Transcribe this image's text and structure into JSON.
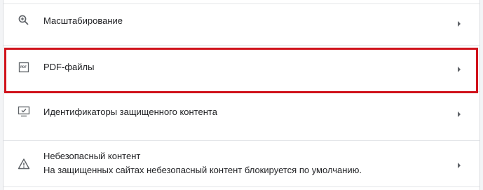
{
  "settings": {
    "rows": [
      {
        "icon": "zoom-icon",
        "label": "Масштабирование"
      },
      {
        "icon": "pdf-icon",
        "label": "PDF-файлы",
        "pdf_badge": "PDF"
      },
      {
        "icon": "protected-content-icon",
        "label": "Идентификаторы защищенного контента"
      },
      {
        "icon": "warning-icon",
        "label": "Небезопасный контент",
        "sublabel": "На защищенных сайтах небезопасный контент блокируется по умолчанию."
      }
    ]
  },
  "colors": {
    "highlight": "#d0121b",
    "icon": "#5f6368",
    "text": "#202124",
    "divider": "#e3e5e8"
  }
}
